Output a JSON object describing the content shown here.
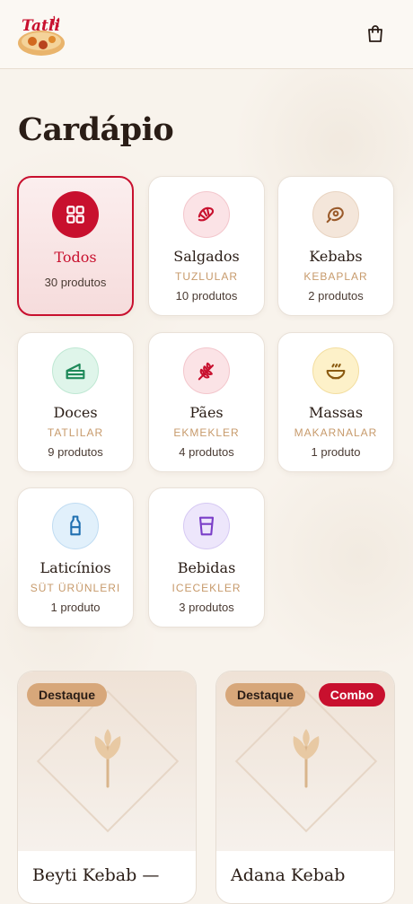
{
  "header": {
    "logo_text": "Tatli",
    "logo_icon": "restaurant-logo",
    "cart_icon": "shopping-bag-icon"
  },
  "title": "Cardápio",
  "categories": [
    {
      "name": "Todos",
      "sub": "",
      "count": "30 produtos",
      "icon": "grid-icon",
      "active": true,
      "icon_bg": "#c8102e",
      "icon_color": "#ffffff"
    },
    {
      "name": "Salgados",
      "sub": "TUZLULAR",
      "count": "10 produtos",
      "icon": "croissant-icon",
      "active": false,
      "icon_bg": "#fbe3e6",
      "icon_color": "#c8102e"
    },
    {
      "name": "Kebabs",
      "sub": "KEBAPLAR",
      "count": "2 produtos",
      "icon": "meat-icon",
      "active": false,
      "icon_bg": "#f4e6da",
      "icon_color": "#9a5a2a"
    },
    {
      "name": "Doces",
      "sub": "TATLILAR",
      "count": "9 produtos",
      "icon": "cake-icon",
      "active": false,
      "icon_bg": "#dff5ea",
      "icon_color": "#1f8a5a"
    },
    {
      "name": "Pães",
      "sub": "EKMEKLER",
      "count": "4 produtos",
      "icon": "wheat-icon",
      "active": false,
      "icon_bg": "#fbe3e6",
      "icon_color": "#c8102e"
    },
    {
      "name": "Massas",
      "sub": "MAKARNALAR",
      "count": "1 produto",
      "icon": "soup-bowl-icon",
      "active": false,
      "icon_bg": "#fdf1c9",
      "icon_color": "#8a5a10"
    },
    {
      "name": "Laticínios",
      "sub": "SÜT ÜRÜNLERI",
      "count": "1 produto",
      "icon": "milk-bottle-icon",
      "active": false,
      "icon_bg": "#e1f0fb",
      "icon_color": "#1f6fb0"
    },
    {
      "name": "Bebidas",
      "sub": "ICECEKLER",
      "count": "3 produtos",
      "icon": "cup-icon",
      "active": false,
      "icon_bg": "#ede6fb",
      "icon_color": "#7a3ec8"
    }
  ],
  "products": [
    {
      "name": "Beyti Kebab —",
      "badges": [
        "Destaque"
      ]
    },
    {
      "name": "Adana Kebab",
      "badges": [
        "Destaque",
        "Combo"
      ]
    }
  ],
  "colors": {
    "accent": "#c8102e",
    "badge_destaque": "#d7a77a",
    "subtitle": "#c79a6b",
    "background": "#f8f3ec"
  }
}
